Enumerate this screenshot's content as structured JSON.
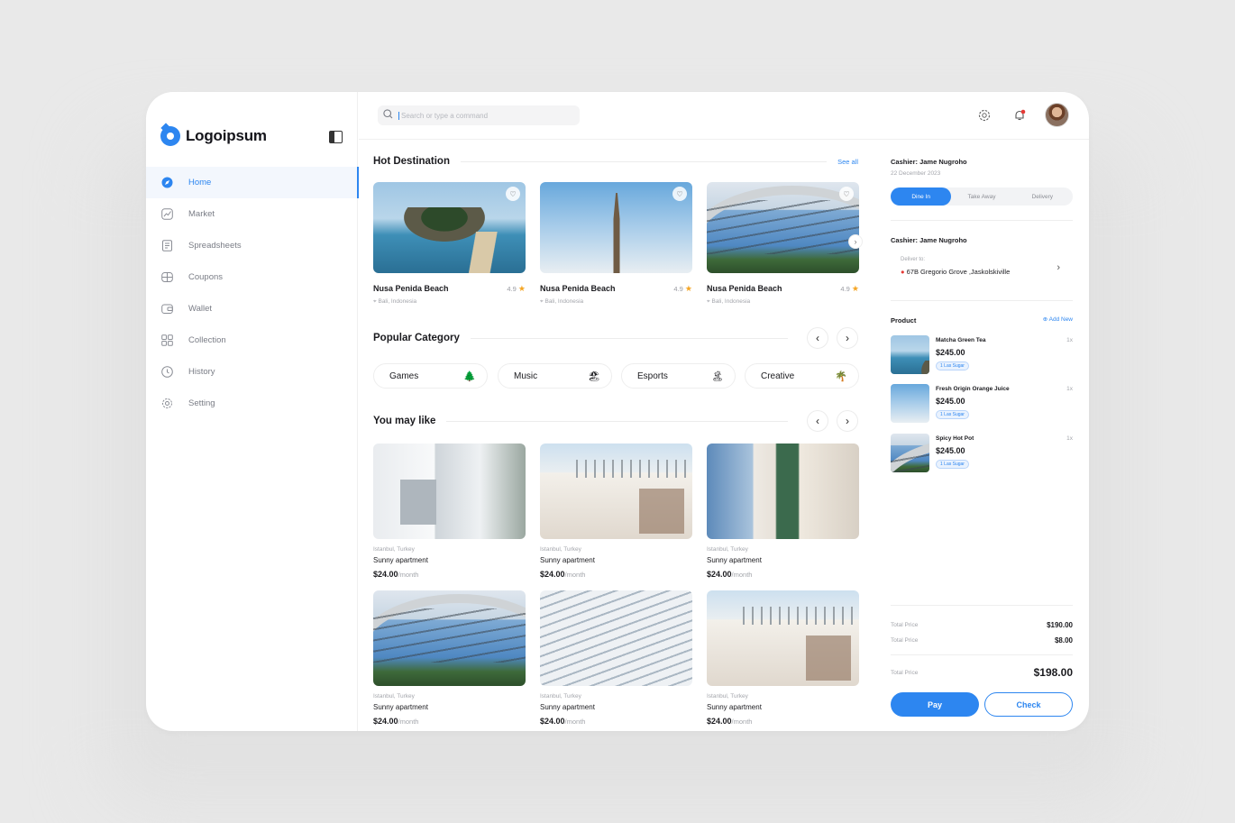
{
  "brand": {
    "name": "Logoipsum",
    "accent": "#2d86f0"
  },
  "sidebar": {
    "items": [
      {
        "label": "Home",
        "icon": "compass-icon",
        "active": true
      },
      {
        "label": "Market",
        "icon": "chart-icon",
        "active": false
      },
      {
        "label": "Spreadsheets",
        "icon": "document-icon",
        "active": false
      },
      {
        "label": "Coupons",
        "icon": "ticket-icon",
        "active": false
      },
      {
        "label": "Wallet",
        "icon": "wallet-icon",
        "active": false
      },
      {
        "label": "Collection",
        "icon": "grid-icon",
        "active": false
      },
      {
        "label": "History",
        "icon": "clock-icon",
        "active": false
      },
      {
        "label": "Setting",
        "icon": "gear-icon",
        "active": false
      }
    ]
  },
  "topbar": {
    "search_placeholder": "Search or type a command"
  },
  "hot": {
    "title": "Hot Destination",
    "see_all": "See all",
    "cards": [
      {
        "name": "Nusa Penida Beach",
        "rating": "4.9",
        "location": "Bali, Indonesia"
      },
      {
        "name": "Nusa Penida Beach",
        "rating": "4.9",
        "location": "Bali, Indonesia"
      },
      {
        "name": "Nusa Penida Beach",
        "rating": "4.9",
        "location": "Bali, Indonesia"
      }
    ]
  },
  "popular": {
    "title": "Popular Category",
    "categories": [
      {
        "label": "Games",
        "emoji": "🌲"
      },
      {
        "label": "Music",
        "emoji": "🏖"
      },
      {
        "label": "Esports",
        "emoji": "🏝"
      },
      {
        "label": "Creative",
        "emoji": "🌴"
      }
    ]
  },
  "like": {
    "title": "You may like",
    "cards": [
      {
        "location": "Istanbul, Turkey",
        "name": "Sunny apartment",
        "price": "$24.00",
        "period": "/month"
      },
      {
        "location": "Istanbul, Turkey",
        "name": "Sunny apartment",
        "price": "$24.00",
        "period": "/month"
      },
      {
        "location": "Istanbul, Turkey",
        "name": "Sunny apartment",
        "price": "$24.00",
        "period": "/month"
      },
      {
        "location": "Istanbul, Turkey",
        "name": "Sunny apartment",
        "price": "$24.00",
        "period": "/month"
      },
      {
        "location": "Istanbul, Turkey",
        "name": "Sunny apartment",
        "price": "$24.00",
        "period": "/month"
      },
      {
        "location": "Istanbul, Turkey",
        "name": "Sunny apartment",
        "price": "$24.00",
        "period": "/month"
      }
    ]
  },
  "order": {
    "cashier": "Cashier: Jame Nugroho",
    "date": "22 December 2023",
    "modes": [
      "Dine In",
      "Take Away",
      "Delivery"
    ],
    "active_mode": "Dine In",
    "cashier2": "Cashier: Jame Nugroho",
    "deliver_label": "Deliver to:",
    "deliver_address": "67B Gregorio Grove ,Jaskolskiville",
    "product_title": "Product",
    "add_new": "Add New",
    "products": [
      {
        "name": "Matcha Green Tea",
        "price": "$245.00",
        "tag": "1 Las Sugar",
        "qty": "1x"
      },
      {
        "name": "Fresh Origin Orange Juice",
        "price": "$245.00",
        "tag": "1 Las Sugar",
        "qty": "1x"
      },
      {
        "name": "Spicy Hot Pot",
        "price": "$245.00",
        "tag": "1 Las Sugar",
        "qty": "1x"
      }
    ],
    "totals": [
      {
        "label": "Total Price",
        "value": "$190.00"
      },
      {
        "label": "Total Price",
        "value": "$8.00"
      }
    ],
    "grand": {
      "label": "Total Price",
      "value": "$198.00"
    },
    "pay": "Pay",
    "check": "Check"
  }
}
